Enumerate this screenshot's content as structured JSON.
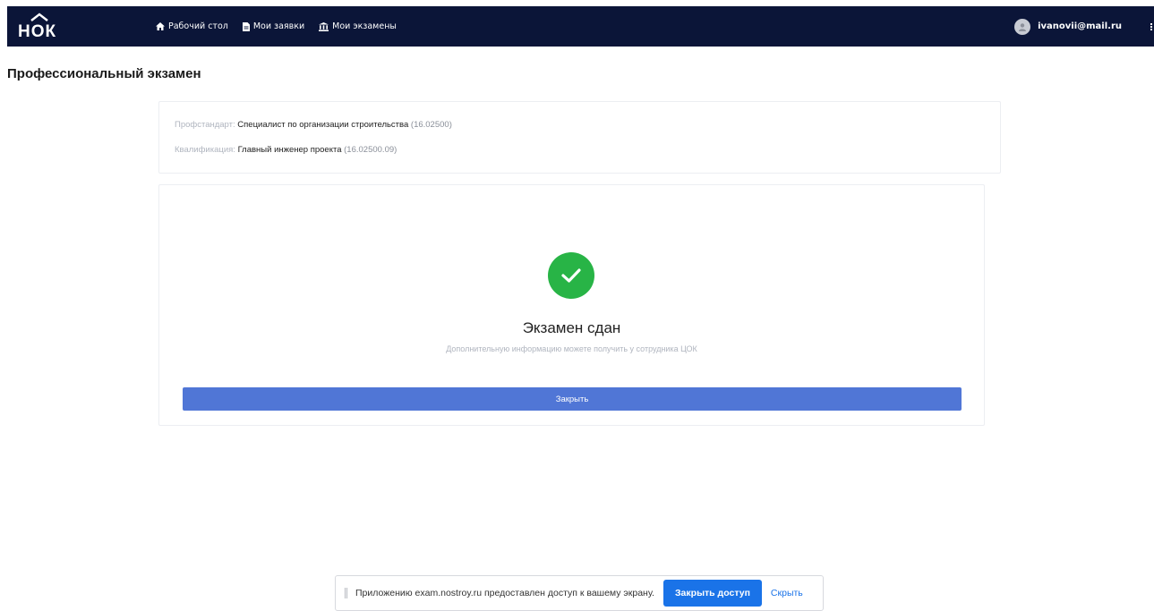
{
  "header": {
    "logo": "НОК",
    "nav": [
      {
        "label": "Рабочий стол",
        "icon": "home-icon"
      },
      {
        "label": "Мои заявки",
        "icon": "document-icon"
      },
      {
        "label": "Мои экзамены",
        "icon": "institution-icon"
      }
    ],
    "user_email": "ivanovii@mail.ru"
  },
  "page": {
    "title": "Профессиональный экзамен"
  },
  "info": {
    "standard_label": "Профстандарт:",
    "standard_value": "Специалист по организации строительства",
    "standard_code": "(16.02500)",
    "qualification_label": "Квалификация:",
    "qualification_value": "Главный инженер проекта",
    "qualification_code": "(16.02500.09)"
  },
  "result": {
    "title": "Экзамен сдан",
    "subtitle": "Дополнительную информацию можете получить у сотрудника ЦОК",
    "close_label": "Закрыть",
    "status_color": "#28b446",
    "button_color": "#5076d6"
  },
  "share_bar": {
    "message": "Приложению exam.nostroy.ru предоставлен доступ к вашему экрану.",
    "stop_label": "Закрыть доступ",
    "hide_label": "Скрыть"
  },
  "colors": {
    "topbar": "#0b1538",
    "accent": "#1a73e8"
  }
}
